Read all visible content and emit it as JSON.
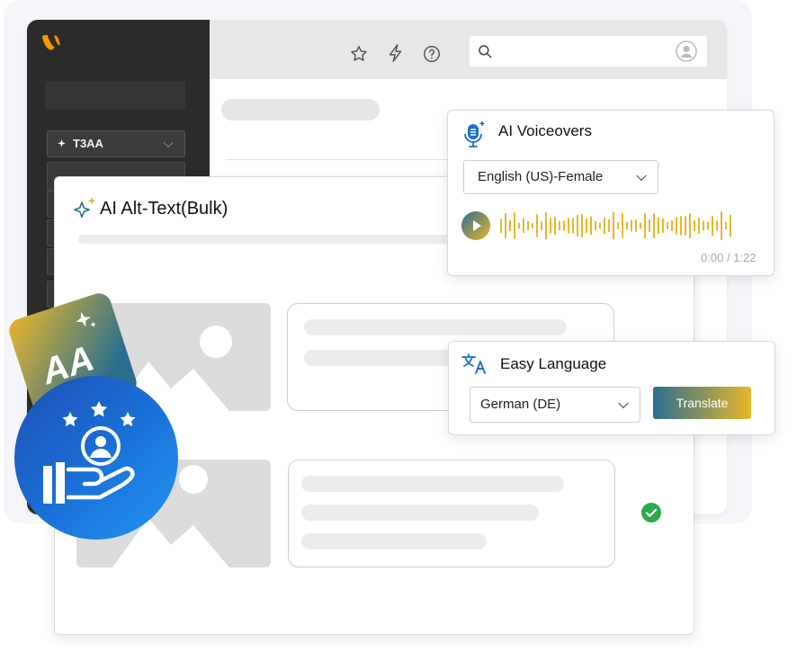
{
  "sidebar": {
    "site_label": "T3AA"
  },
  "alt_text": {
    "title": "AI Alt-Text(Bulk)"
  },
  "voiceovers": {
    "title": "AI Voiceovers",
    "voice_select": "English (US)-Female",
    "time_current": "0:00",
    "time_separator": "/",
    "time_total": "1:22"
  },
  "easy_language": {
    "title": "Easy Language",
    "language_select": "German (DE)",
    "translate_label": "Translate"
  },
  "badge": {
    "aa_text": "AA"
  },
  "colors": {
    "accent_blue": "#1a6fd6",
    "gold": "#e8b62b",
    "teal": "#2b6f8f",
    "typo3_orange": "#f49700",
    "success": "#2daa4a"
  }
}
